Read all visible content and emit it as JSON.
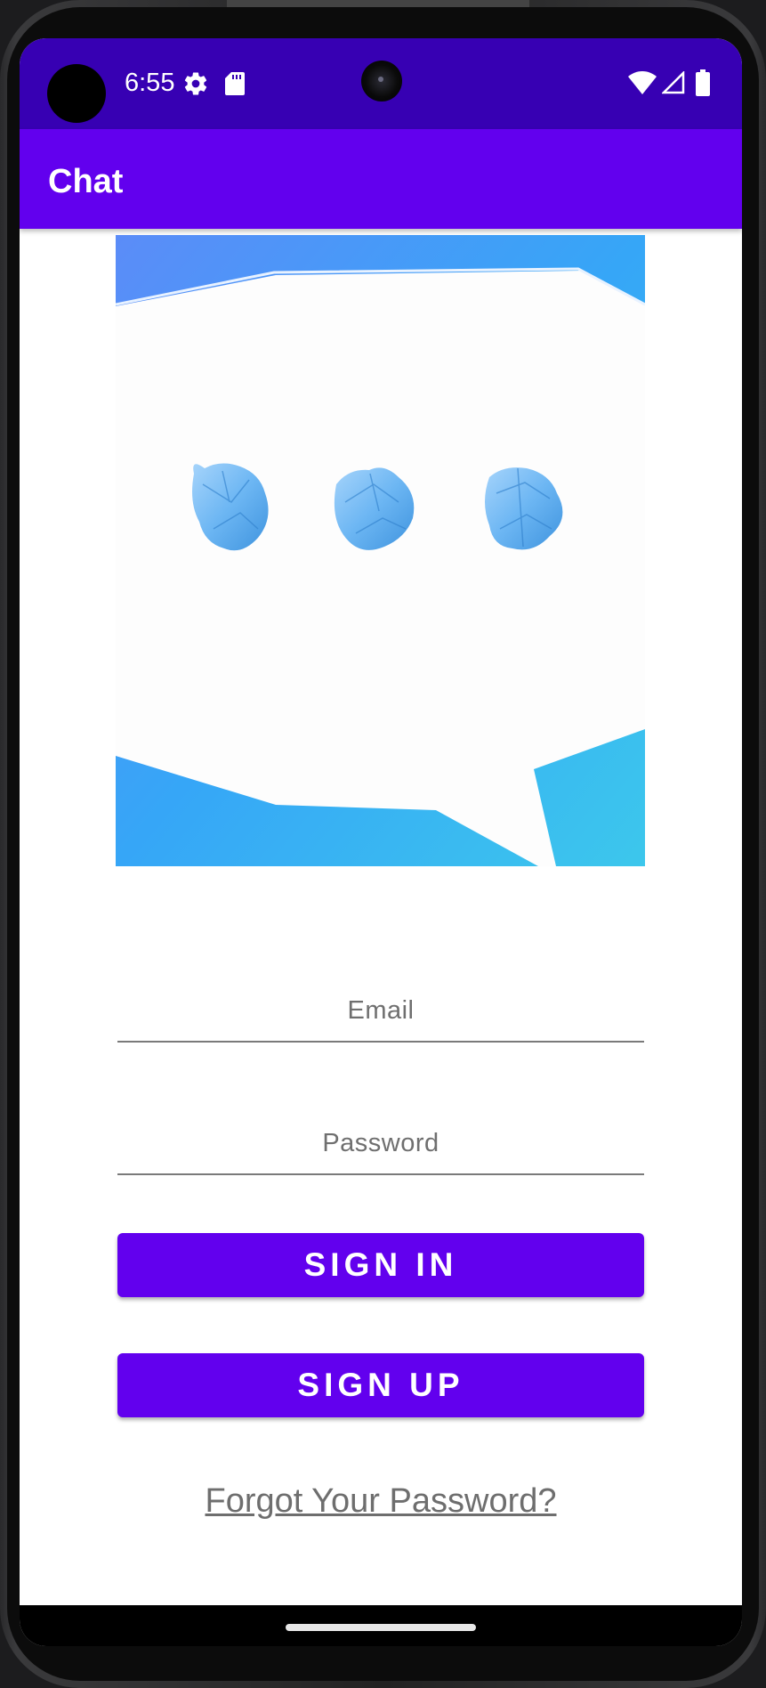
{
  "status_bar": {
    "time": "6:55",
    "icons": [
      "avatar",
      "settings-icon",
      "sd-card-icon",
      "wifi-icon",
      "signal-icon",
      "battery-icon"
    ]
  },
  "app_bar": {
    "title": "Chat"
  },
  "hero": {
    "image": "chat-bubble-with-three-crumpled-paper-balls"
  },
  "form": {
    "email_placeholder": "Email",
    "email_value": "",
    "password_placeholder": "Password",
    "password_value": ""
  },
  "actions": {
    "sign_in_label": "SIGN IN",
    "sign_up_label": "SIGN UP",
    "forgot_password_label": "Forgot Your Password?"
  },
  "colors": {
    "status_bar": "#3700b3",
    "primary": "#6200ee",
    "on_primary": "#ffffff",
    "bubble_blue": "#3fa9f5"
  }
}
